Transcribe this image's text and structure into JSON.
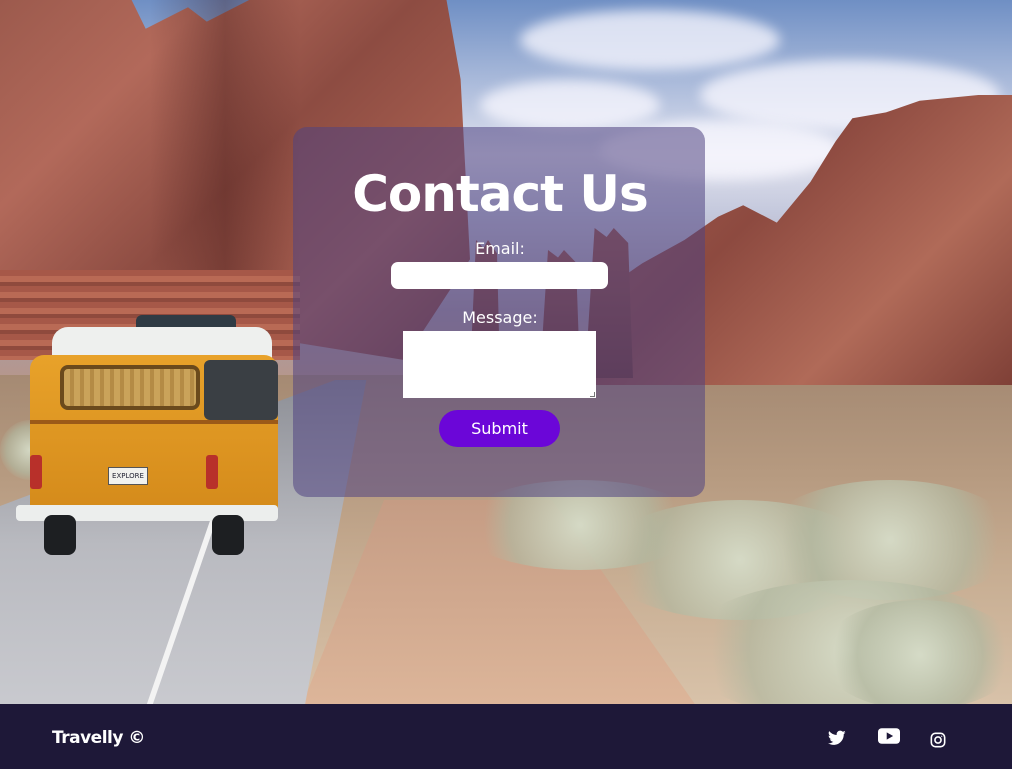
{
  "contact": {
    "title": "Contact Us",
    "email_label": "Email:",
    "email_value": "",
    "message_label": "Message:",
    "message_value": "",
    "submit_label": "Submit"
  },
  "footer": {
    "brand": "Travelly ©",
    "social": [
      {
        "name": "twitter-icon"
      },
      {
        "name": "youtube-icon"
      },
      {
        "name": "instagram-icon"
      }
    ]
  },
  "scene": {
    "van_plate": "EXPLORE"
  },
  "colors": {
    "panel_overlay": "#50448299",
    "submit_button": "#6b06d8",
    "footer_bg": "#1e1838",
    "text": "#ffffff"
  }
}
